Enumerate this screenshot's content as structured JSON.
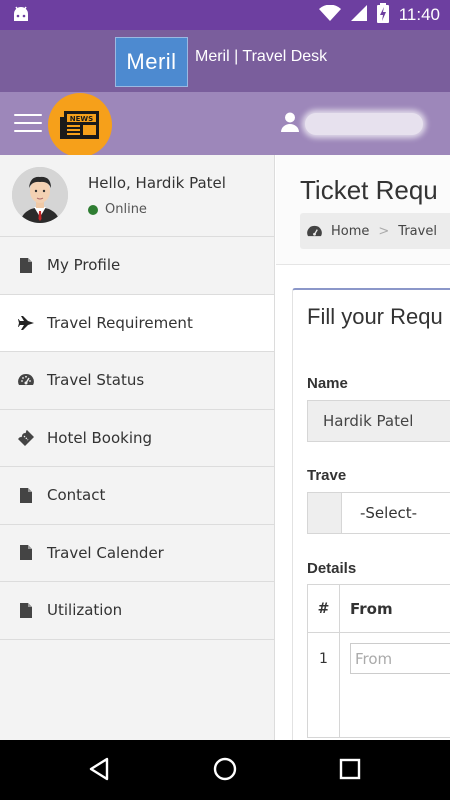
{
  "status_bar": {
    "time": "11:40"
  },
  "brand": {
    "logo_text": "Meril",
    "title": "Meril | Travel Desk"
  },
  "toolbar": {
    "news_badge": "NEWS"
  },
  "user": {
    "greeting": "Hello, Hardik Patel",
    "status": "Online"
  },
  "sidebar": {
    "items": [
      {
        "label": "My Profile",
        "icon": "file-icon"
      },
      {
        "label": "Travel Requirement",
        "icon": "plane-icon"
      },
      {
        "label": "Travel Status",
        "icon": "dashboard-icon"
      },
      {
        "label": "Hotel Booking",
        "icon": "ticket-icon"
      },
      {
        "label": "Contact",
        "icon": "file-icon"
      },
      {
        "label": "Travel Calender",
        "icon": "file-icon"
      },
      {
        "label": "Utilization",
        "icon": "file-icon"
      }
    ]
  },
  "main": {
    "page_title": "Ticket Requ",
    "breadcrumb": {
      "home": "Home",
      "sep": ">",
      "current": "Travel"
    },
    "form": {
      "title": "Fill your Requ",
      "name_label": "Name",
      "name_value": "Hardik Patel",
      "travel_label": "Trave",
      "travel_value": "-Select-",
      "details_label": "Details",
      "table": {
        "col_num": "#",
        "col_from": "From",
        "rows": [
          {
            "num": "1",
            "from_placeholder": "From"
          }
        ]
      }
    }
  },
  "colors": {
    "status_bar": "#6d3fa0",
    "brand_bar": "#7a5e9c",
    "toolbar": "#9d87ba",
    "news_badge": "#f6a01a",
    "online": "#2e7d32"
  }
}
